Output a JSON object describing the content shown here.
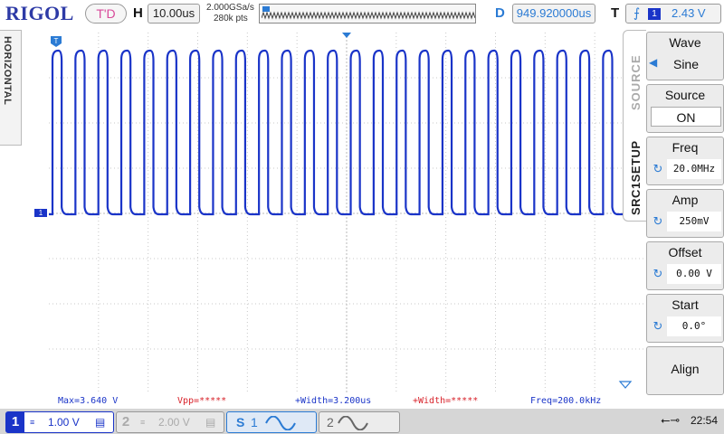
{
  "header": {
    "brand": "RIGOL",
    "mode": "T'D",
    "timebase_label": "H",
    "timebase": "10.00us",
    "sample_rate": "2.000GSa/s",
    "memory_depth": "280k pts",
    "delay_label": "D",
    "delay": "949.920000us",
    "trigger_label": "T",
    "trigger_source": "1",
    "trigger_level": "2.43 V"
  },
  "left_tab": {
    "label": "HORIZONTAL"
  },
  "menu": {
    "tab_source": "SOURCE",
    "tab_setup": "SRC1SETUP",
    "items": [
      {
        "label": "Wave",
        "value": "Sine"
      },
      {
        "label": "Source",
        "value": "ON"
      },
      {
        "label": "Freq",
        "value": "20.0MHz"
      },
      {
        "label": "Amp",
        "value": "250mV"
      },
      {
        "label": "Offset",
        "value": "0.00 V"
      },
      {
        "label": "Start",
        "value": "0.0°"
      },
      {
        "label": "Align"
      }
    ]
  },
  "measurements": {
    "max": "Max=3.640 V",
    "vpp": "Vpp=*****",
    "pos_width": "+Width=3.200us",
    "pos_width_2": "+Width=*****",
    "freq": "Freq=200.0kHz"
  },
  "channels": {
    "ch1": {
      "num": "1",
      "scale": "1.00 V"
    },
    "ch2": {
      "num": "2",
      "scale": "2.00 V"
    },
    "src1": {
      "label": "S",
      "num": "1"
    },
    "src2": {
      "num": "2"
    }
  },
  "status": {
    "time": "22:54"
  },
  "waveform": {
    "channel": "1",
    "channel_marker": "1",
    "trigger_marker": "T",
    "periods_visible": 26,
    "duty_high_fraction": 0.36,
    "colors": {
      "ch1": "#1a34c8",
      "grid": "#c8c8c8",
      "accent": "#2b7bd4"
    }
  }
}
